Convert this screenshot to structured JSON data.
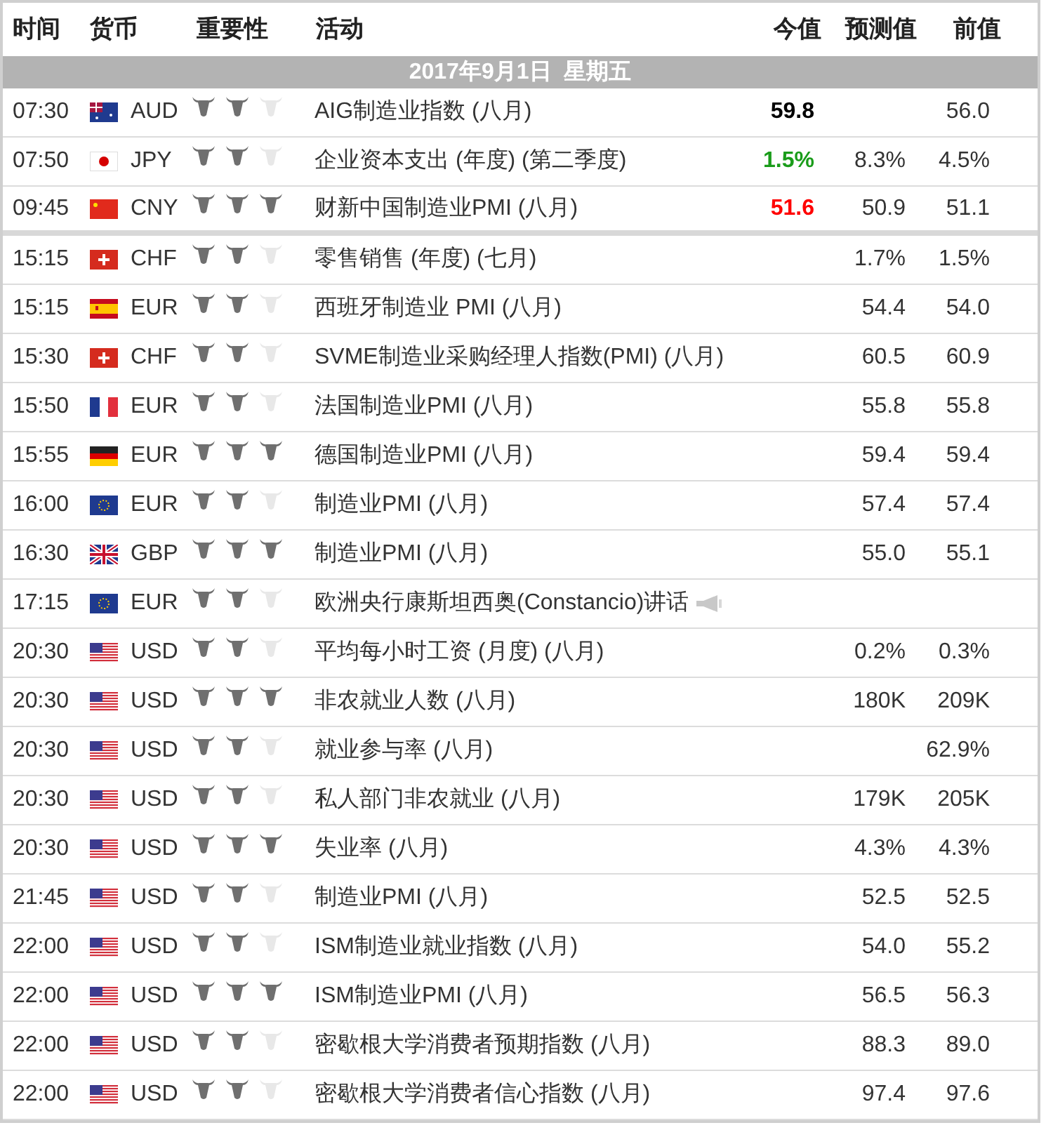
{
  "columns": [
    "时间",
    "货币",
    "重要性",
    "活动",
    "今值",
    "预测值",
    "前值"
  ],
  "date": "2017年9月1日  星期五",
  "rows": [
    {
      "time": "07:30",
      "flag": {
        "kind": "au"
      },
      "currency": "AUD",
      "stars": 2,
      "event": "AIG制造业指数 (八月)",
      "actual": {
        "value": "59.8",
        "color": "#000000"
      },
      "previous": "56.0"
    },
    {
      "time": "07:50",
      "flag": {
        "kind": "jp"
      },
      "currency": "JPY",
      "stars": 2,
      "event": "企业资本支出 (年度) (第二季度)",
      "actual": {
        "value": "1.5%",
        "color": "#1a9c1a"
      },
      "forecast": "8.3%",
      "previous": "4.5%"
    },
    {
      "time": "09:45",
      "flag": {
        "kind": "cn"
      },
      "currency": "CNY",
      "stars": 3,
      "event": "财新中国制造业PMI (八月)",
      "actual": {
        "value": "51.6",
        "color": "#ff0000"
      },
      "forecast": "50.9",
      "previous": "51.1",
      "divider_after": true
    },
    {
      "time": "15:15",
      "flag": {
        "kind": "ch"
      },
      "currency": "CHF",
      "stars": 2,
      "event": "零售销售 (年度) (七月)",
      "forecast": "1.7%",
      "previous": "1.5%"
    },
    {
      "time": "15:15",
      "flag": {
        "kind": "es"
      },
      "currency": "EUR",
      "stars": 2,
      "event": "西班牙制造业 PMI (八月)",
      "forecast": "54.4",
      "previous": "54.0"
    },
    {
      "time": "15:30",
      "flag": {
        "kind": "ch"
      },
      "currency": "CHF",
      "stars": 2,
      "event": "SVME制造业采购经理人指数(PMI) (八月)",
      "forecast": "60.5",
      "previous": "60.9"
    },
    {
      "time": "15:50",
      "flag": {
        "kind": "fr"
      },
      "currency": "EUR",
      "stars": 2,
      "event": "法国制造业PMI (八月)",
      "forecast": "55.8",
      "previous": "55.8"
    },
    {
      "time": "15:55",
      "flag": {
        "kind": "de"
      },
      "currency": "EUR",
      "stars": 3,
      "event": "德国制造业PMI (八月)",
      "forecast": "59.4",
      "previous": "59.4"
    },
    {
      "time": "16:00",
      "flag": {
        "kind": "eu"
      },
      "currency": "EUR",
      "stars": 2,
      "event": "制造业PMI (八月)",
      "forecast": "57.4",
      "previous": "57.4"
    },
    {
      "time": "16:30",
      "flag": {
        "kind": "gb"
      },
      "currency": "GBP",
      "stars": 3,
      "event": "制造业PMI (八月)",
      "forecast": "55.0",
      "previous": "55.1"
    },
    {
      "time": "17:15",
      "flag": {
        "kind": "eu"
      },
      "currency": "EUR",
      "stars": 2,
      "event": "欧洲央行康斯坦西奥(Constancio)讲话",
      "kind": "speech"
    },
    {
      "time": "20:30",
      "flag": {
        "kind": "us"
      },
      "currency": "USD",
      "stars": 2,
      "event": "平均每小时工资 (月度) (八月)",
      "forecast": "0.2%",
      "previous": "0.3%"
    },
    {
      "time": "20:30",
      "flag": {
        "kind": "us"
      },
      "currency": "USD",
      "stars": 3,
      "event": "非农就业人数 (八月)",
      "forecast": "180K",
      "previous": "209K"
    },
    {
      "time": "20:30",
      "flag": {
        "kind": "us"
      },
      "currency": "USD",
      "stars": 2,
      "event": "就业参与率 (八月)",
      "previous": "62.9%"
    },
    {
      "time": "20:30",
      "flag": {
        "kind": "us"
      },
      "currency": "USD",
      "stars": 2,
      "event": "私人部门非农就业 (八月)",
      "forecast": "179K",
      "previous": "205K"
    },
    {
      "time": "20:30",
      "flag": {
        "kind": "us"
      },
      "currency": "USD",
      "stars": 3,
      "event": "失业率 (八月)",
      "forecast": "4.3%",
      "previous": "4.3%"
    },
    {
      "time": "21:45",
      "flag": {
        "kind": "us"
      },
      "currency": "USD",
      "stars": 2,
      "event": "制造业PMI (八月)",
      "forecast": "52.5",
      "previous": "52.5"
    },
    {
      "time": "22:00",
      "flag": {
        "kind": "us"
      },
      "currency": "USD",
      "stars": 2,
      "event": "ISM制造业就业指数 (八月)",
      "forecast": "54.0",
      "previous": "55.2"
    },
    {
      "time": "22:00",
      "flag": {
        "kind": "us"
      },
      "currency": "USD",
      "stars": 3,
      "event": "ISM制造业PMI (八月)",
      "forecast": "56.5",
      "previous": "56.3"
    },
    {
      "time": "22:00",
      "flag": {
        "kind": "us"
      },
      "currency": "USD",
      "stars": 2,
      "event": "密歇根大学消费者预期指数 (八月)",
      "forecast": "88.3",
      "previous": "89.0"
    },
    {
      "time": "22:00",
      "flag": {
        "kind": "us"
      },
      "currency": "USD",
      "stars": 2,
      "event": "密歇根大学消费者信心指数 (八月)",
      "forecast": "97.4",
      "previous": "97.6"
    }
  ]
}
